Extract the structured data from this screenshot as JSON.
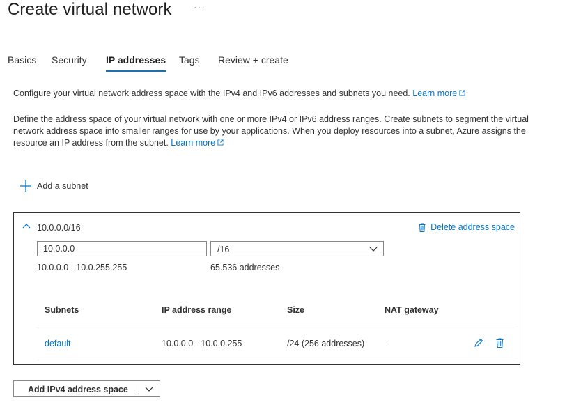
{
  "page": {
    "title": "Create virtual network",
    "more": "···"
  },
  "tabs": [
    {
      "label": "Basics"
    },
    {
      "label": "Security"
    },
    {
      "label": "IP addresses",
      "active": true
    },
    {
      "label": "Tags"
    },
    {
      "label": "Review + create"
    }
  ],
  "intro": {
    "text": "Configure your virtual network address space with the IPv4 and IPv6 addresses and subnets you need.",
    "link": "Learn more"
  },
  "description": {
    "text": "Define the address space of your virtual network with one or more IPv4 or IPv6 address ranges. Create subnets to segment the virtual network address space into smaller ranges for use by your applications. When you deploy resources into a subnet, Azure assigns the resource an IP address from the subnet.",
    "link": "Learn more"
  },
  "add_subnet": {
    "label": "Add a subnet"
  },
  "address_space": {
    "title": "10.0.0.0/16",
    "delete_label": "Delete address space",
    "ip_value": "10.0.0.0",
    "prefix_value": "/16",
    "range": "10.0.0.0 - 10.0.255.255",
    "count": "65.536 addresses",
    "table": {
      "headers": [
        "Subnets",
        "IP address range",
        "Size",
        "NAT gateway"
      ],
      "rows": [
        {
          "name": "default",
          "range": "10.0.0.0 - 10.0.0.255",
          "size": "/24 (256 addresses)",
          "nat": "-"
        }
      ]
    }
  },
  "add_space_button": {
    "label": "Add IPv4 address space"
  },
  "colors": {
    "accent": "#0078d4",
    "text": "#323130",
    "border": "#8a8886"
  },
  "icons": [
    "more-icon",
    "plus-icon",
    "chevron-up-icon",
    "trash-icon",
    "chevron-down-icon",
    "pencil-icon",
    "external-link-icon"
  ]
}
